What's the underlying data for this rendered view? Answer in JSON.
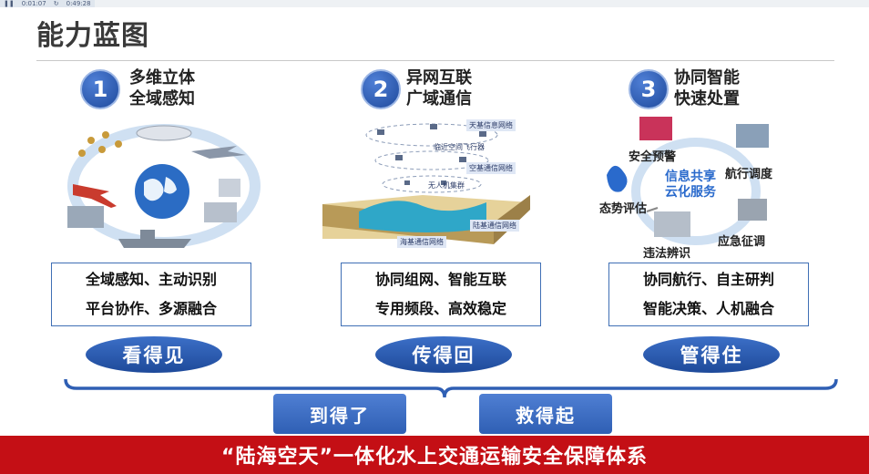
{
  "player": {
    "current_time": "0:01:07",
    "total_time": "0:49:28"
  },
  "title": "能力蓝图",
  "columns": [
    {
      "num": "1",
      "line1": "多维立体",
      "line2": "全域感知",
      "box": [
        "全域感知、主动识别",
        "平台协作、多源融合"
      ],
      "oval": "看得见"
    },
    {
      "num": "2",
      "line1": "异网互联",
      "line2": "广域通信",
      "box": [
        "协同组网、智能互联",
        "专用频段、高效稳定"
      ],
      "oval": "传得回"
    },
    {
      "num": "3",
      "line1": "协同智能",
      "line2": "快速处置",
      "box": [
        "协同航行、自主研判",
        "智能决策、人机融合"
      ],
      "oval": "管得住"
    }
  ],
  "network_labels": {
    "space": "天基信息网络",
    "near_space": "临近空间飞行器",
    "air": "空基通信网络",
    "uav": "无人机集群",
    "land": "陆基通信网络",
    "sea": "海基通信网络"
  },
  "cloud": {
    "center_line1": "信息共享",
    "center_line2": "云化服务",
    "items": [
      "安全预警",
      "航行调度",
      "态势评估",
      "应急征调",
      "违法辨识"
    ]
  },
  "buttons": [
    "到得了",
    "救得起"
  ],
  "banner": "“陆海空天”一体化水上交通运输安全保障体系",
  "colors": {
    "accent_blue": "#2f5fb4",
    "banner_red": "#c40f15"
  }
}
